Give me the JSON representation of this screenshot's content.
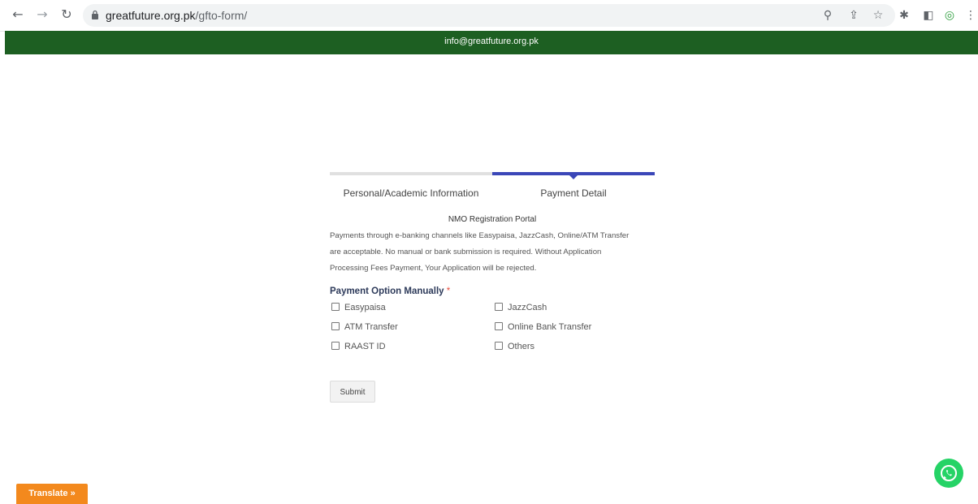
{
  "browser": {
    "url_host": "greatfuture.org.pk",
    "url_path": "/gfto-form/",
    "icons": [
      "back-icon",
      "forward-icon",
      "reload-icon",
      "lock-icon",
      "zoom-icon",
      "share-icon",
      "star-icon",
      "extensions-icon",
      "sidebar-icon",
      "extension-badge-icon",
      "menu-icon"
    ]
  },
  "topbar": {
    "email": "info@greatfuture.org.pk",
    "color": "#1d5f22"
  },
  "steps": [
    {
      "label": "Personal/Academic Information",
      "active": false
    },
    {
      "label": "Payment Detail",
      "active": true
    }
  ],
  "form": {
    "portal_title": "NMO Registration Portal",
    "description_lines": [
      "Payments through e-banking channels like Easypaisa, JazzCash, Online/ATM Transfer",
      "are acceptable. No manual or bank submission is required. Without Application",
      "Processing Fees Payment, Your Application will be rejected."
    ],
    "payment_label": "Payment Option Manually",
    "required_mark": "*",
    "options": [
      "Easypaisa",
      "JazzCash",
      "ATM Transfer",
      "Online Bank Transfer",
      "RAAST ID",
      "Others"
    ],
    "submit_label": "Submit"
  },
  "widgets": {
    "translate_label": "Translate »",
    "whatsapp_icon": "whatsapp-icon"
  },
  "colors": {
    "accent": "#3b47b8",
    "translate": "#f3891d",
    "whatsapp": "#25d366"
  }
}
